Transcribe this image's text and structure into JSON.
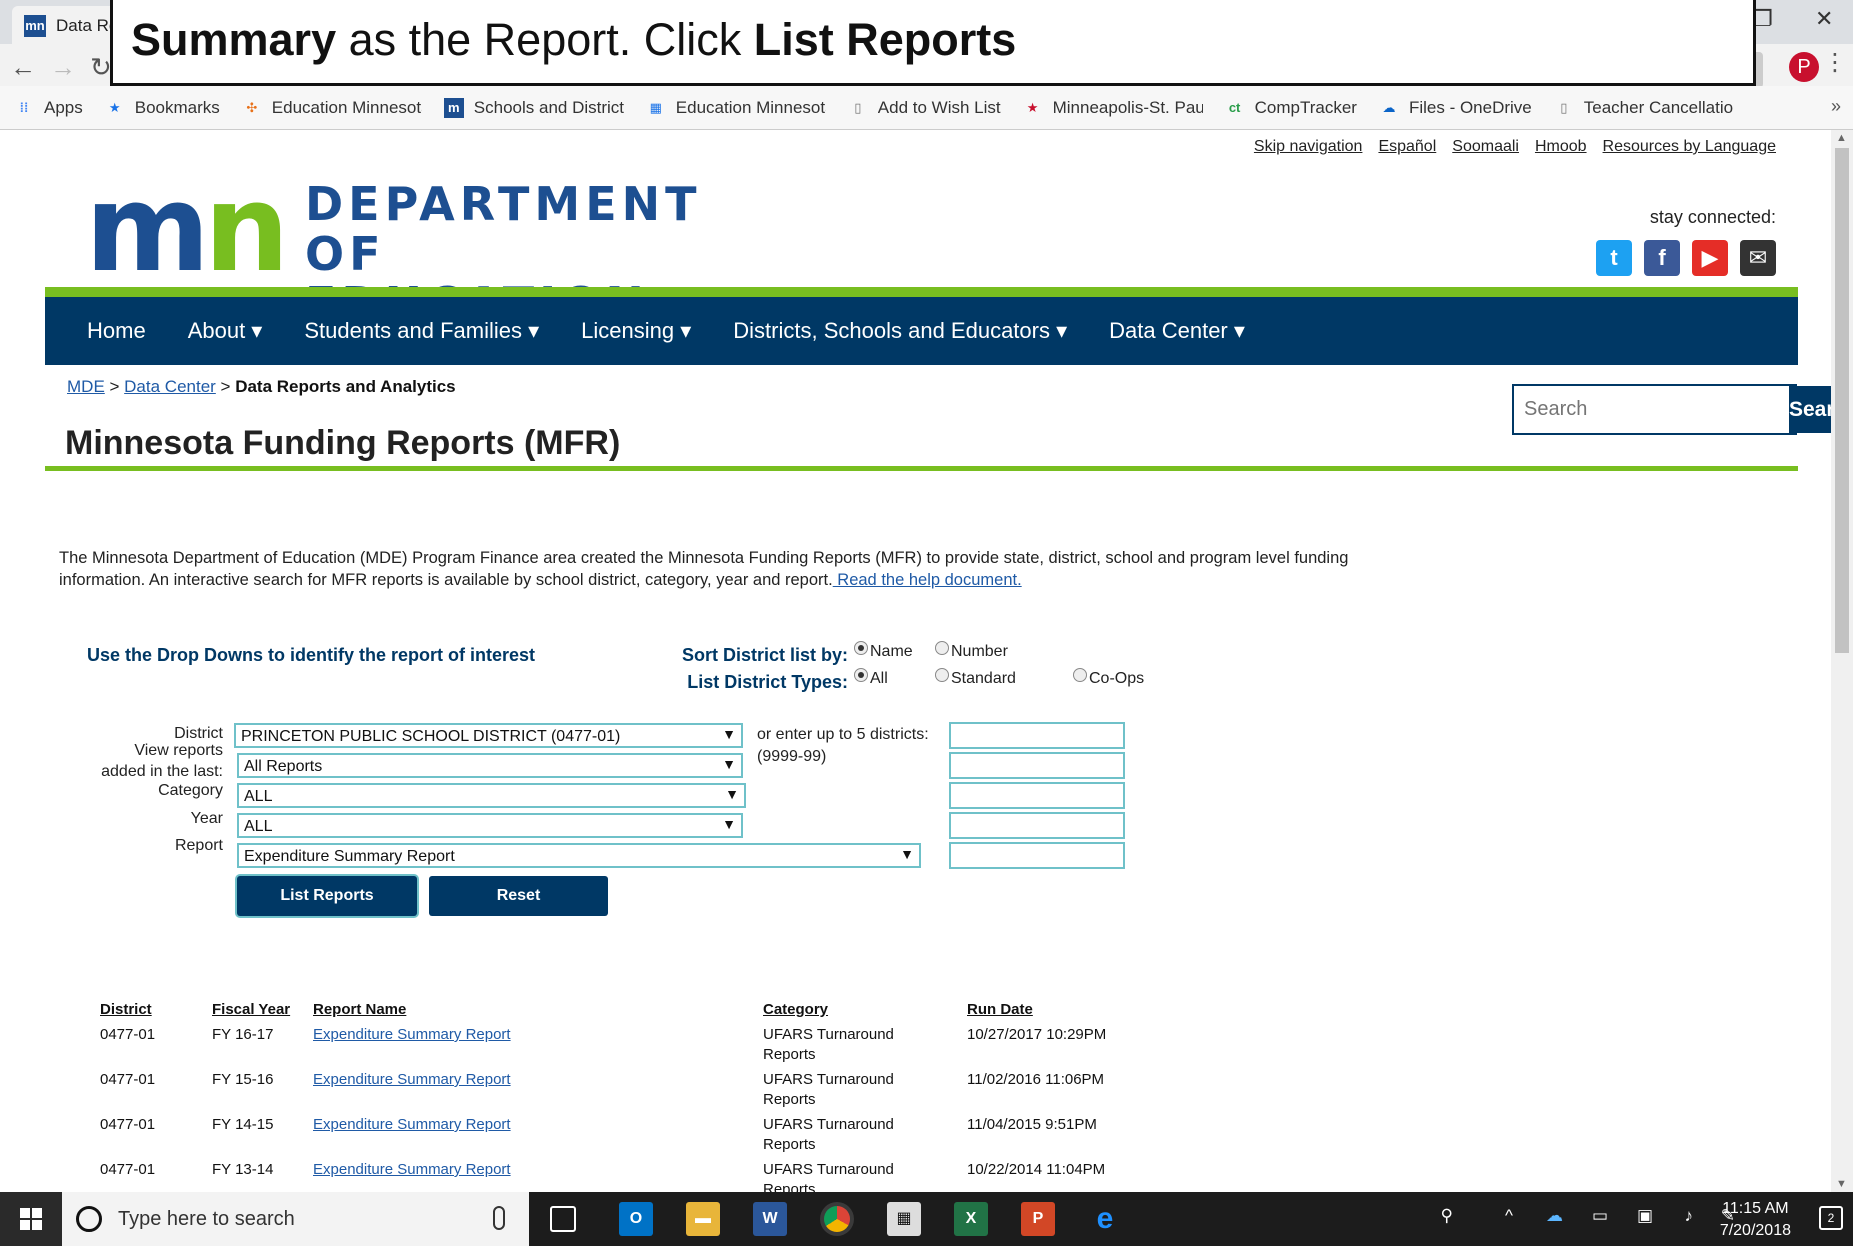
{
  "browser": {
    "tab_title": "Data Re",
    "tab_favicon": "mn",
    "bookmarks": [
      {
        "icon": "apps-grid-icon",
        "label": "Apps"
      },
      {
        "icon": "star-icon",
        "label": "Bookmarks"
      },
      {
        "icon": "pinwheel-icon",
        "label": "Education Minnesota"
      },
      {
        "icon": "mn-icon",
        "label": "Schools and Districts"
      },
      {
        "icon": "table-icon",
        "label": "Education Minnesota"
      },
      {
        "icon": "page-icon",
        "label": "Add to Wish List"
      },
      {
        "icon": "red-star-icon",
        "label": "Minneapolis-St. Paul"
      },
      {
        "icon": "ct-icon",
        "label": "CompTracker"
      },
      {
        "icon": "onedrive-cloud-icon",
        "label": "Files - OneDrive"
      },
      {
        "icon": "page-icon",
        "label": "Teacher Cancellation"
      }
    ],
    "more_bookmarks": "»"
  },
  "callout": {
    "bold1": "Summary",
    "text1": " as the Report.  Click ",
    "bold2": "List Reports"
  },
  "utility_links": [
    "Skip navigation",
    "Español",
    "Soomaali",
    "Hmoob",
    "Resources by Language"
  ],
  "logo": {
    "mark": "mn",
    "line1": "DEPARTMENT",
    "line2": "OF EDUCATION"
  },
  "stay_connected": "stay connected:",
  "social": [
    {
      "icon": "twitter-icon",
      "glyph": "t",
      "color": "#1da1f2"
    },
    {
      "icon": "facebook-icon",
      "glyph": "f",
      "color": "#3b5998"
    },
    {
      "icon": "youtube-icon",
      "glyph": "▶",
      "color": "#e52d27"
    },
    {
      "icon": "email-icon",
      "glyph": "✉",
      "color": "#333333"
    }
  ],
  "nav": [
    "Home",
    "About ▾",
    "Students and Families ▾",
    "Licensing ▾",
    "Districts, Schools and Educators ▾",
    "Data Center ▾"
  ],
  "breadcrumb": {
    "link1": "MDE",
    "sep1": " > ",
    "link2": "Data Center",
    "sep2": " > ",
    "current": "Data Reports and Analytics"
  },
  "search": {
    "placeholder": "Search",
    "button": "Search"
  },
  "page_title": "Minnesota Funding Reports (MFR)",
  "intro": {
    "text": "The Minnesota Department of Education (MDE) Program Finance area created the Minnesota Funding Reports (MFR) to provide state, district, school and program level funding information. An interactive search for MFR reports is available by school district, category, year and report.",
    "link": " Read the help document."
  },
  "form": {
    "heading": "Use the Drop Downs to identify the report of interest",
    "sort_label": "Sort District list by:",
    "sort_options": [
      "Name",
      "Number"
    ],
    "types_label": "List District Types:",
    "type_options": [
      "All",
      "Standard",
      "Co-Ops"
    ],
    "district_label": "District",
    "district_value": "PRINCETON PUBLIC SCHOOL DISTRICT  (0477-01)",
    "view_label_1": "View reports",
    "view_label_2": "added in the last:",
    "view_value": "All Reports",
    "category_label": "Category",
    "category_value": "ALL",
    "year_label": "Year",
    "year_value": "ALL",
    "report_label": "Report",
    "report_value": "Expenditure Summary Report",
    "enter_label": "or enter up to 5 districts:",
    "enter_format": "(9999-99)",
    "list_button": "List Reports",
    "reset_button": "Reset"
  },
  "table": {
    "headers": [
      "District",
      "Fiscal Year",
      "Report Name",
      "Category",
      "Run Date"
    ],
    "rows": [
      {
        "district": "0477-01",
        "year": "FY 16-17",
        "name": "Expenditure Summary Report",
        "cat1": "UFARS Turnaround",
        "cat2": "Reports",
        "run": "10/27/2017 10:29PM"
      },
      {
        "district": "0477-01",
        "year": "FY 15-16",
        "name": "Expenditure Summary Report",
        "cat1": "UFARS Turnaround",
        "cat2": "Reports",
        "run": "11/02/2016 11:06PM"
      },
      {
        "district": "0477-01",
        "year": "FY 14-15",
        "name": "Expenditure Summary Report",
        "cat1": "UFARS Turnaround",
        "cat2": "Reports",
        "run": "11/04/2015 9:51PM"
      },
      {
        "district": "0477-01",
        "year": "FY 13-14",
        "name": "Expenditure Summary Report",
        "cat1": "UFARS Turnaround",
        "cat2": "Reports",
        "run": "10/22/2014 11:04PM"
      }
    ]
  },
  "taskbar": {
    "search_placeholder": "Type here to search",
    "time": "11:15 AM",
    "date": "7/20/2018",
    "notifications": "2"
  }
}
